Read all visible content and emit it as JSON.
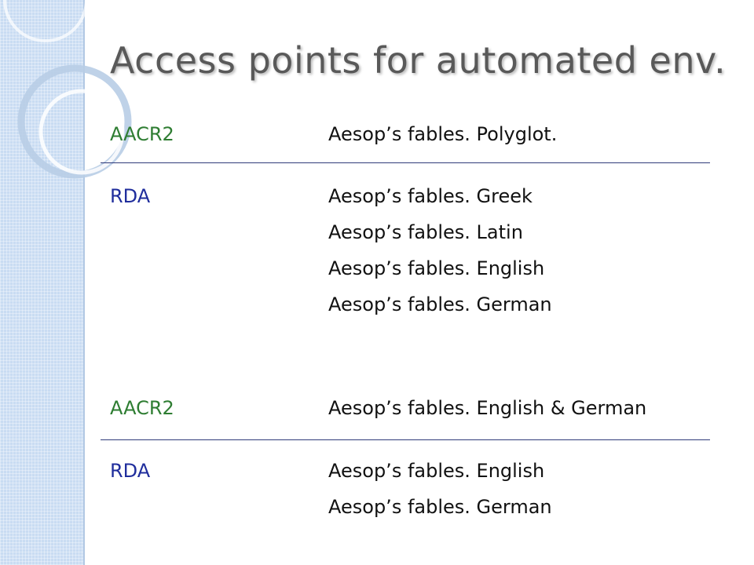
{
  "slide": {
    "title": "Access points for automated env.",
    "colors": {
      "aacr2": "#2e7d32",
      "rda": "#1f2d9c",
      "title": "#595959",
      "sidebar": "#c9dcf2"
    },
    "example1": {
      "aacr2": {
        "label": "AACR2",
        "headings": [
          "Aesop’s fables. Polyglot."
        ]
      },
      "rda": {
        "label": "RDA",
        "headings": [
          "Aesop’s fables. Greek",
          "Aesop’s fables. Latin",
          "Aesop’s fables. English",
          "Aesop’s fables. German"
        ]
      }
    },
    "example2": {
      "aacr2": {
        "label": "AACR2",
        "headings": [
          "Aesop’s fables. English & German"
        ]
      },
      "rda": {
        "label": "RDA",
        "headings": [
          "Aesop’s fables. English",
          "Aesop’s fables. German"
        ]
      }
    }
  }
}
